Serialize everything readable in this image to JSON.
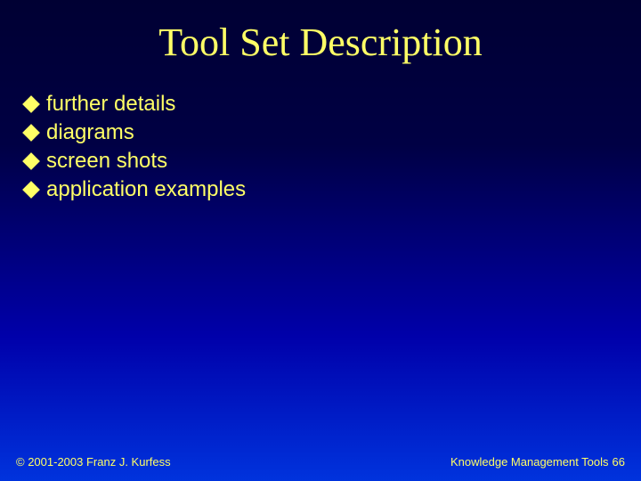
{
  "title": "Tool Set Description",
  "bullets": [
    "further details",
    "diagrams",
    "screen shots",
    "application examples"
  ],
  "footer": {
    "copyright": "© 2001-2003 Franz J. Kurfess",
    "topic": "Knowledge Management Tools",
    "page": "66"
  }
}
